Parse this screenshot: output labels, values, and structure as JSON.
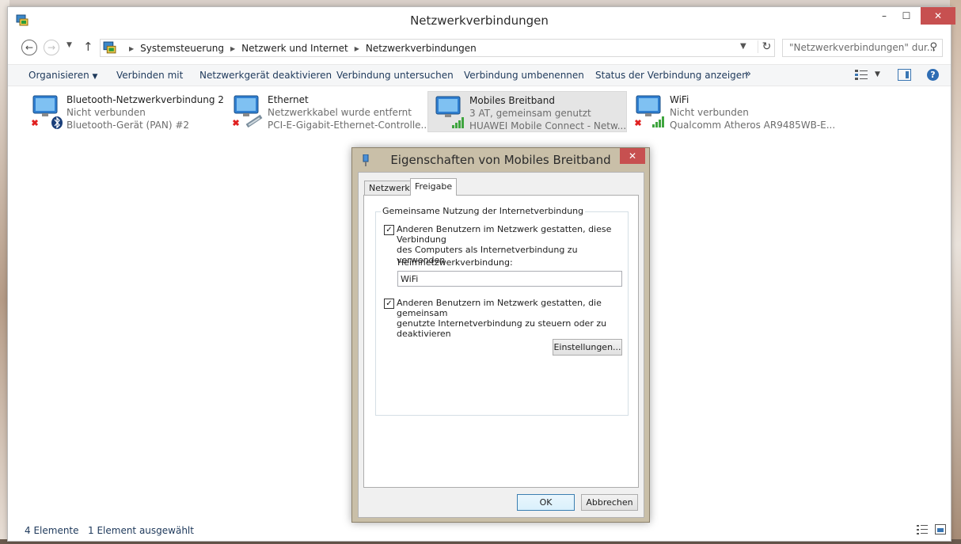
{
  "window": {
    "title": "Netzwerkverbindungen",
    "minimize_glyph": "–",
    "maximize_glyph": "☐",
    "close_glyph": "✕"
  },
  "address": {
    "crumbs": [
      "Systemsteuerung",
      "Netzwerk und Internet",
      "Netzwerkverbindungen"
    ],
    "search_placeholder": "\"Netzwerkverbindungen\" dur..."
  },
  "commandbar": {
    "organize": "Organisieren",
    "connect": "Verbinden mit",
    "disable": "Netzwerkgerät deaktivieren",
    "diagnose": "Verbindung untersuchen",
    "rename": "Verbindung umbenennen",
    "status": "Status der Verbindung anzeigen",
    "more": "»"
  },
  "connections": [
    {
      "name": "Bluetooth-Netzwerkverbindung 2",
      "status": "Nicht verbunden",
      "device": "Bluetooth-Gerät (PAN) #2"
    },
    {
      "name": "Ethernet",
      "status": "Netzwerkkabel wurde entfernt",
      "device": "PCI-E-Gigabit-Ethernet-Controlle..."
    },
    {
      "name": "Mobiles Breitband",
      "status": "3 AT, gemeinsam genutzt",
      "device": "HUAWEI Mobile Connect - Netw..."
    },
    {
      "name": "WiFi",
      "status": "Nicht verbunden",
      "device": "Qualcomm Atheros AR9485WB-E..."
    }
  ],
  "statusbar": {
    "count": "4 Elemente",
    "selected": "1 Element ausgewählt"
  },
  "dialog": {
    "title": "Eigenschaften von Mobiles Breitband",
    "close_glyph": "✕",
    "tabs": [
      "Netzwerk",
      "Freigabe"
    ],
    "active_tab": "Freigabe",
    "group_title": "Gemeinsame Nutzung der Internetverbindung",
    "cb1_line1": "Anderen Benutzern im Netzwerk gestatten, diese Verbindung",
    "cb1_line2": "des Computers als Internetverbindung zu verwenden",
    "cb1_checked": true,
    "home_label": "Heimnetzwerkverbindung:",
    "home_value": "WiFi",
    "cb2_line1": "Anderen Benutzern im Netzwerk gestatten, die gemeinsam",
    "cb2_line2": "genutzte Internetverbindung zu steuern oder zu deaktivieren",
    "cb2_checked": true,
    "settings_button": "Einstellungen...",
    "ok_button": "OK",
    "cancel_button": "Abbrechen",
    "check_glyph": "✓"
  }
}
